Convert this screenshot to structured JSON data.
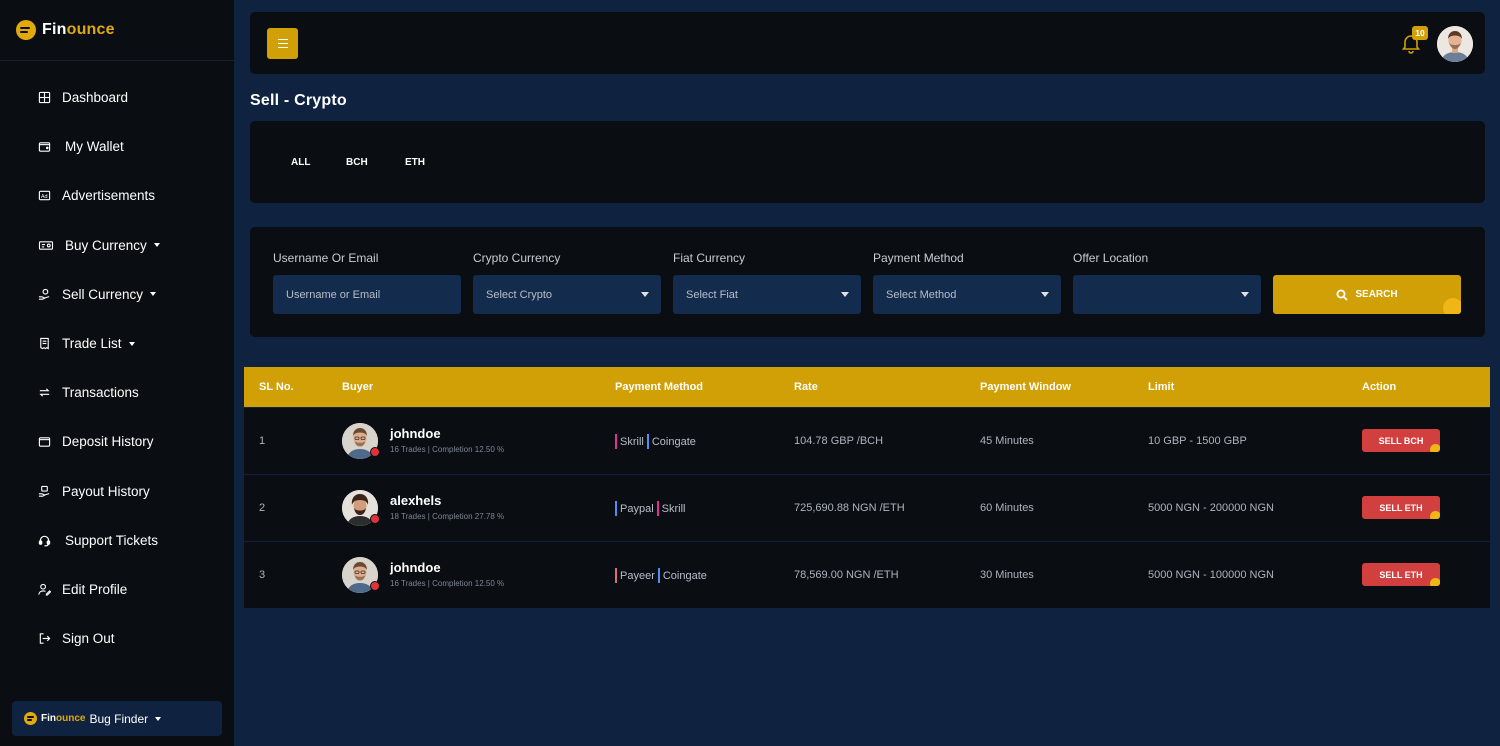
{
  "brand": {
    "part1": "Fin",
    "part2": "ounce"
  },
  "sidebar": {
    "items": [
      {
        "label": "Dashboard",
        "icon": "grid-icon",
        "dropdown": false
      },
      {
        "label": "My Wallet",
        "icon": "wallet-icon",
        "dropdown": false
      },
      {
        "label": "Advertisements",
        "icon": "ad-icon",
        "dropdown": false
      },
      {
        "label": "Buy Currency",
        "icon": "money-icon",
        "dropdown": true
      },
      {
        "label": "Sell Currency",
        "icon": "hand-coin-icon",
        "dropdown": true
      },
      {
        "label": "Trade List",
        "icon": "receipt-icon",
        "dropdown": true
      },
      {
        "label": "Transactions",
        "icon": "exchange-icon",
        "dropdown": false
      },
      {
        "label": "Deposit History",
        "icon": "wallet-icon",
        "dropdown": false
      },
      {
        "label": "Payout History",
        "icon": "hand-money-icon",
        "dropdown": false
      },
      {
        "label": "Support Tickets",
        "icon": "headset-icon",
        "dropdown": false
      },
      {
        "label": "Edit Profile",
        "icon": "user-edit-icon",
        "dropdown": false
      },
      {
        "label": "Sign Out",
        "icon": "sign-out-icon",
        "dropdown": false
      }
    ],
    "account": {
      "label": "Bug Finder"
    }
  },
  "topbar": {
    "notification_count": "10"
  },
  "page_title": "Sell - Crypto",
  "tabs": [
    "ALL",
    "BCH",
    "ETH"
  ],
  "filters": {
    "username": {
      "label": "Username Or Email",
      "placeholder": "Username or Email"
    },
    "crypto": {
      "label": "Crypto Currency",
      "value": "Select Crypto"
    },
    "fiat": {
      "label": "Fiat Currency",
      "value": "Select Fiat"
    },
    "method": {
      "label": "Payment Method",
      "value": "Select Method"
    },
    "location": {
      "label": "Offer Location",
      "value": ""
    },
    "search_label": "SEARCH"
  },
  "table": {
    "headers": [
      "SL No.",
      "Buyer",
      "Payment Method",
      "Rate",
      "Payment Window",
      "Limit",
      "Action"
    ],
    "rows": [
      {
        "sl": "1",
        "name": "johndoe",
        "meta": "16 Trades | Completion 12.50 %",
        "methods": [
          {
            "name": "Skrill",
            "color": "#e0309a"
          },
          {
            "name": "Coingate",
            "color": "#4f8ef7"
          }
        ],
        "rate": "104.78 GBP /BCH",
        "window": "45 Minutes",
        "limit": "10 GBP - 1500 GBP",
        "action": "SELL BCH"
      },
      {
        "sl": "2",
        "name": "alexhels",
        "meta": "18 Trades | Completion 27.78 %",
        "methods": [
          {
            "name": "Paypal",
            "color": "#4f8ef7"
          },
          {
            "name": "Skrill",
            "color": "#e0309a"
          }
        ],
        "rate": "725,690.88 NGN /ETH",
        "window": "60 Minutes",
        "limit": "5000 NGN - 200000 NGN",
        "action": "SELL ETH"
      },
      {
        "sl": "3",
        "name": "johndoe",
        "meta": "16 Trades | Completion 12.50 %",
        "methods": [
          {
            "name": "Payeer",
            "color": "#e06a7a"
          },
          {
            "name": "Coingate",
            "color": "#4f8ef7"
          }
        ],
        "rate": "78,569.00 NGN /ETH",
        "window": "30 Minutes",
        "limit": "5000 NGN - 100000 NGN",
        "action": "SELL ETH"
      }
    ]
  },
  "colors": {
    "accent": "#d19f06",
    "danger": "#d23f3f",
    "bg": "#0f2340",
    "panel": "#0a0d12"
  }
}
